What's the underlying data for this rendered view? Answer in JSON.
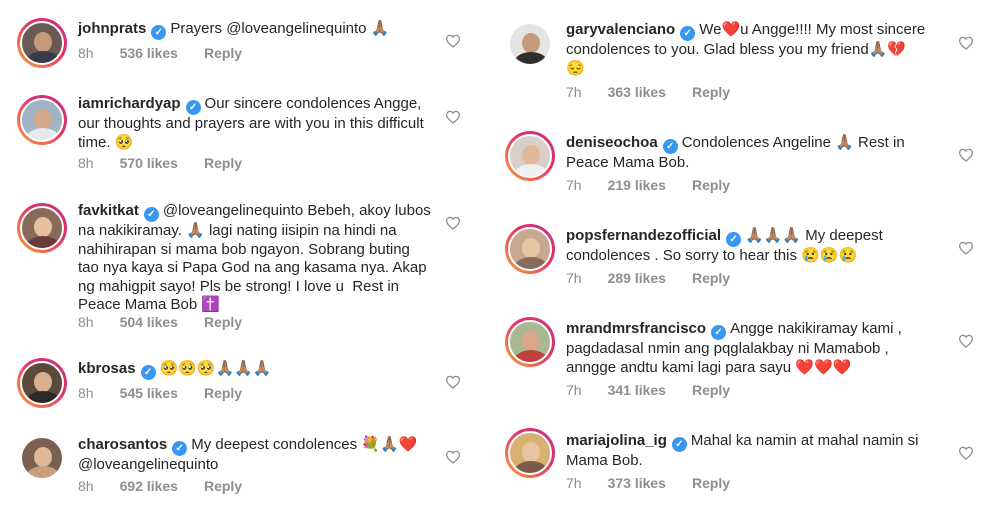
{
  "left": [
    {
      "user": "johnprats",
      "text": "Prayers @loveangelinequinto 🙏🏽",
      "time": "8h",
      "likes": "536 likes",
      "reply": "Reply"
    },
    {
      "user": "iamrichardyap",
      "text": "Our sincere condolences Angge,\nour thoughts and prayers are with you in this difficult\ntime. 🥺",
      "time": "8h",
      "likes": "570 likes",
      "reply": "Reply"
    },
    {
      "user": "favkitkat",
      "text": "@loveangelinequinto Bebeh, akoy lubos\nna nakikiramay. 🙏🏽 lagi nating iisipin na hindi na\nnahihirapan si mama bob ngayon. Sobrang buting\ntao nya kaya si Papa God na ang kasama nya. Akap\nng mahigpit sayo! Pls be strong! I love u  Rest in\nPeace Mama Bob ✝️",
      "time": "8h",
      "likes": "504 likes",
      "reply": "Reply"
    },
    {
      "user": "kbrosas",
      "text": "🥺🥺🥺🙏🏽🙏🏽🙏🏽",
      "time": "8h",
      "likes": "545 likes",
      "reply": "Reply"
    },
    {
      "user": "charosantos",
      "text": "My deepest condolences 💐🙏🏽❤️\n@loveangelinequinto",
      "time": "8h",
      "likes": "692 likes",
      "reply": "Reply"
    }
  ],
  "right": [
    {
      "user": "garyvalenciano",
      "text": "We❤️u Angge!!!! My most sincere\ncondolences to you. Glad bless you my friend🙏🏽💔\n😔",
      "time": "7h",
      "likes": "363 likes",
      "reply": "Reply"
    },
    {
      "user": "deniseochoa",
      "text": "Condolences Angeline 🙏🏽 Rest in\nPeace Mama Bob.",
      "time": "7h",
      "likes": "219 likes",
      "reply": "Reply"
    },
    {
      "user": "popsfernandezofficial",
      "text": "🙏🏽🙏🏽🙏🏽 My deepest\ncondolences . So sorry to hear this 😢😢😢",
      "time": "7h",
      "likes": "289 likes",
      "reply": "Reply"
    },
    {
      "user": "mrandmrsfrancisco",
      "text": "Angge nakikiramay kami ,\npagdadasal nmin ang pqglalakbay ni Mamabob ,\nanngge andtu kami lagi para sayu ❤️❤️❤️",
      "time": "7h",
      "likes": "341 likes",
      "reply": "Reply"
    },
    {
      "user": "mariajolina_ig",
      "text": "Mahal ka namin at mahal namin si\nMama Bob.",
      "time": "7h",
      "likes": "373 likes",
      "reply": "Reply"
    }
  ],
  "colors": {
    "verified": "#3897f0",
    "meta": "#8e8e8e",
    "ring_start": "#f9a23a",
    "ring_end": "#c13584"
  },
  "icons": {
    "verified": "verified-badge-icon",
    "like": "heart-outline-icon"
  }
}
